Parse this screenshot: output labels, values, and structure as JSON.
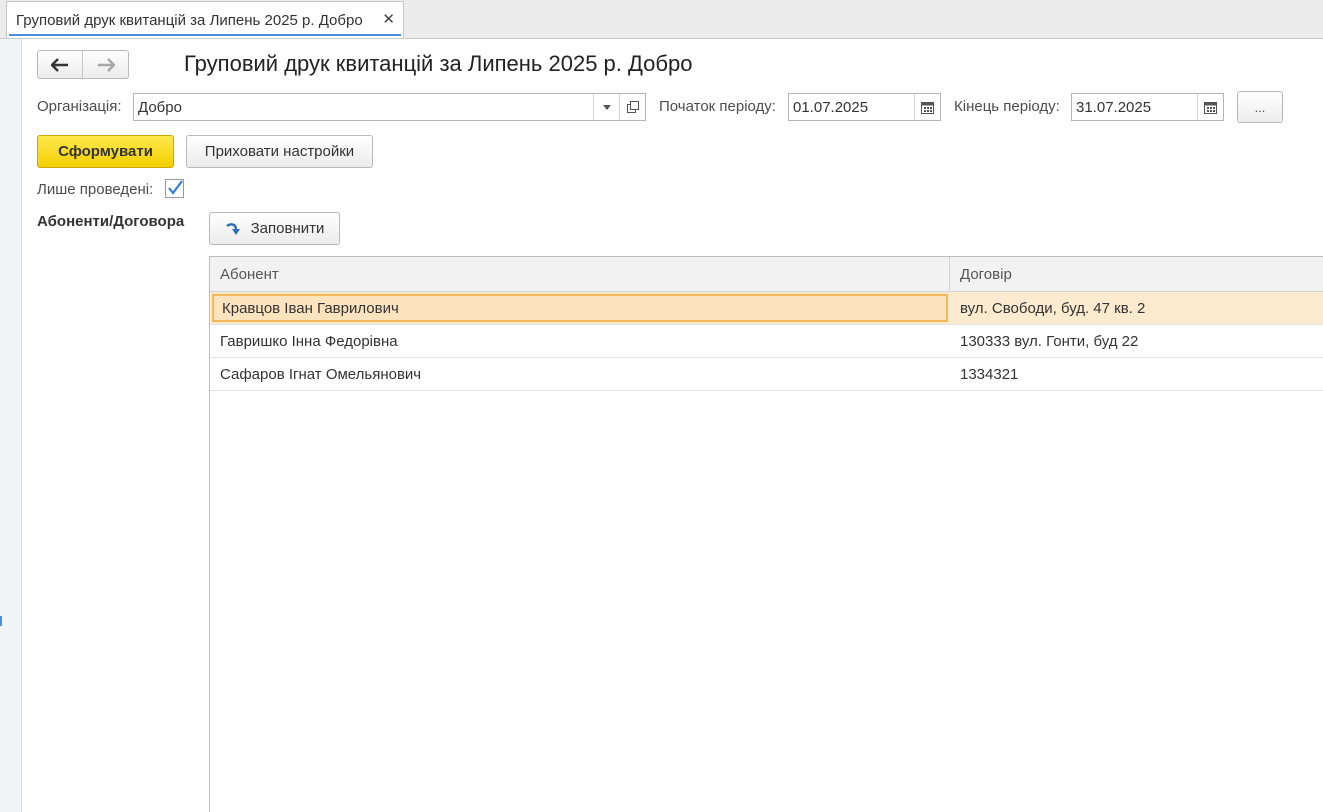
{
  "tab": {
    "title": "Груповий друк квитанцій за Липень 2025 р. Добро",
    "close": "✕"
  },
  "nav": {
    "back": "🡐",
    "forward": "🡒"
  },
  "page": {
    "title": "Груповий друк квитанцій за Липень 2025 р. Добро"
  },
  "form": {
    "organization_label": "Організація:",
    "organization_value": "Добро",
    "period_start_label": "Початок періоду:",
    "period_start_value": "01.07.2025",
    "period_end_label": "Кінець періоду:",
    "period_end_value": "31.07.2025",
    "ellipsis": "..."
  },
  "actions": {
    "generate": "Сформувати",
    "hide_settings": "Приховати настройки"
  },
  "only_posted": {
    "label": "Лише проведені:",
    "checked": true
  },
  "section": {
    "label": "Абоненти/Договора",
    "fill_button": "Заповнити"
  },
  "table": {
    "columns": [
      "Абонент",
      "Договір"
    ],
    "rows": [
      {
        "subscriber": "Кравцов Іван Гаврилович",
        "contract": "вул. Свободи, буд. 47 кв. 2",
        "selected": true
      },
      {
        "subscriber": "Гавришко Інна Федорівна",
        "contract": "130333 вул. Гонти, буд 22",
        "selected": false
      },
      {
        "subscriber": "Сафаров Ігнат Омельянович",
        "contract": "1334321",
        "selected": false
      }
    ]
  },
  "colors": {
    "accent": "#4a90d9",
    "primary_button": "#f5cf00",
    "selected_row": "#fdebd0",
    "selected_border": "#f5b95a"
  }
}
